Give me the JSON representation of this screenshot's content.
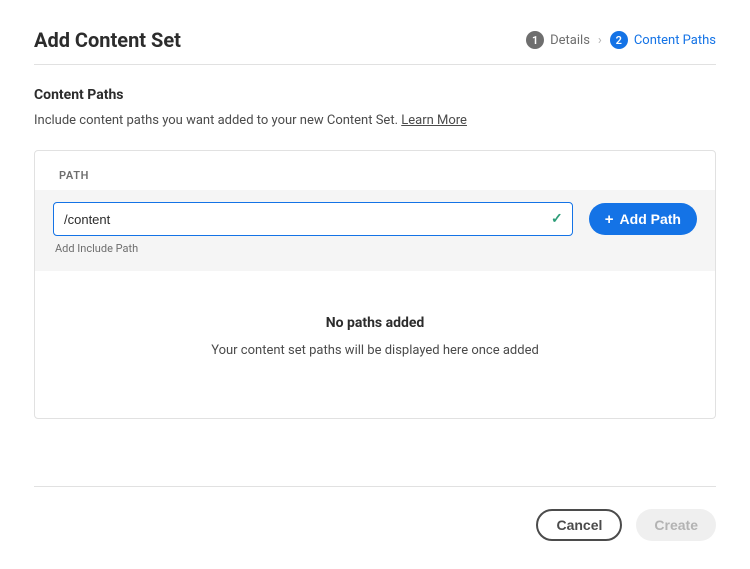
{
  "header": {
    "title": "Add Content Set"
  },
  "stepper": {
    "step1": {
      "number": "1",
      "label": "Details"
    },
    "step2": {
      "number": "2",
      "label": "Content Paths"
    }
  },
  "section": {
    "title": "Content Paths",
    "description_prefix": "Include content paths you want added to your new Content Set. ",
    "learn_more": "Learn More"
  },
  "table": {
    "col_path": "PATH"
  },
  "input": {
    "value": "/content",
    "helper": "Add Include Path"
  },
  "buttons": {
    "add_path": "Add Path",
    "cancel": "Cancel",
    "create": "Create"
  },
  "empty": {
    "title": "No paths added",
    "description": "Your content set paths will be displayed here once added"
  }
}
